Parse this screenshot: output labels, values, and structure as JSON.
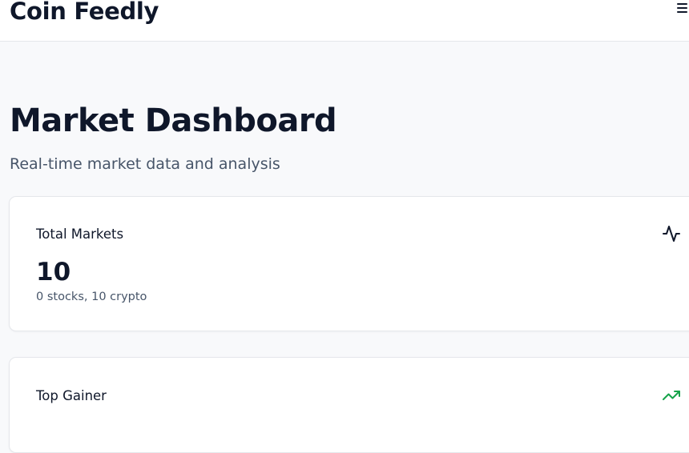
{
  "header": {
    "brand": "Coin Feedly",
    "menu_icon": "hamburger-menu-icon"
  },
  "main": {
    "title": "Market Dashboard",
    "subtitle": "Real-time market data and analysis",
    "cards": [
      {
        "label": "Total Markets",
        "value": "10",
        "sub": "0 stocks, 10 crypto",
        "icon": "activity-pulse-icon",
        "icon_color": "#0f172a"
      },
      {
        "label": "Top Gainer",
        "icon": "trending-up-icon",
        "icon_color": "#16a34a"
      }
    ]
  },
  "colors": {
    "background": "#f8f9fb",
    "surface": "#ffffff",
    "border": "#e5e7eb",
    "text": "#0f172a",
    "muted_text": "#475569",
    "positive": "#16a34a"
  }
}
